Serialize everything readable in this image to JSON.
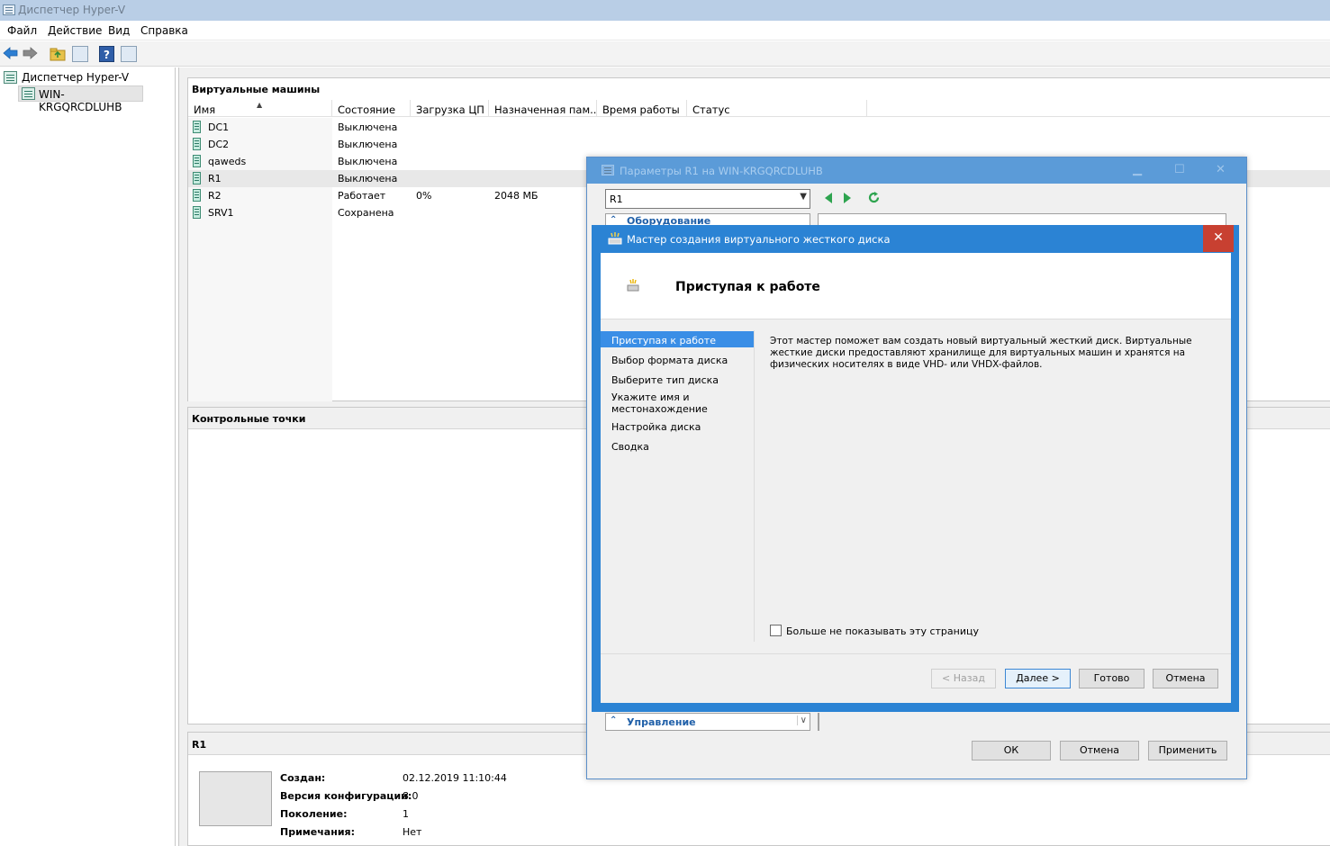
{
  "main_window": {
    "title": "Диспетчер Hyper-V"
  },
  "menu": [
    "Файл",
    "Действие",
    "Вид",
    "Справка"
  ],
  "tree": {
    "root": "Диспетчер Hyper-V",
    "server": "WIN-KRGQRCDLUHB"
  },
  "vm_panel": {
    "title": "Виртуальные машины",
    "columns": [
      "Имя",
      "Состояние",
      "Загрузка ЦП",
      "Назначенная пам...",
      "Время работы",
      "Статус"
    ],
    "rows": [
      {
        "name": "DC1",
        "state": "Выключена",
        "cpu": "",
        "mem": ""
      },
      {
        "name": "DC2",
        "state": "Выключена",
        "cpu": "",
        "mem": ""
      },
      {
        "name": "qaweds",
        "state": "Выключена",
        "cpu": "",
        "mem": ""
      },
      {
        "name": "R1",
        "state": "Выключена",
        "cpu": "",
        "mem": ""
      },
      {
        "name": "R2",
        "state": "Работает",
        "cpu": "0%",
        "mem": "2048 МБ"
      },
      {
        "name": "SRV1",
        "state": "Сохранена",
        "cpu": "",
        "mem": ""
      }
    ]
  },
  "checkpoints_panel": {
    "title": "Контрольные точки"
  },
  "details_panel": {
    "title": "R1",
    "fields": [
      {
        "label": "Создан:",
        "value": "02.12.2019 11:10:44"
      },
      {
        "label": "Версия конфигурации:",
        "value": "8.0"
      },
      {
        "label": "Поколение:",
        "value": "1"
      },
      {
        "label": "Примечания:",
        "value": "Нет"
      }
    ]
  },
  "settings_dialog": {
    "title": "Параметры R1 на WIN-KRGQRCDLUHB",
    "vm_select": "R1",
    "hardware_header": "Оборудование",
    "management_header": "Управление",
    "ok_label": "ОК",
    "cancel_label": "Отмена",
    "apply_label": "Применить"
  },
  "wizard": {
    "title": "Мастер создания виртуального жесткого диска",
    "heading": "Приступая к работе",
    "steps": [
      "Приступая к работе",
      "Выбор формата диска",
      "Выберите тип диска",
      "Укажите имя и местонахождение",
      "Настройка диска",
      "Сводка"
    ],
    "active_step": 0,
    "description": "Этот мастер поможет вам создать новый виртуальный жесткий диск. Виртуальные жесткие диски предоставляют хранилище для виртуальных машин и хранятся на физических носителях в виде VHD- или VHDX-файлов.",
    "checkbox_label": "Больше не показывать эту страницу",
    "back_label": "< Назад",
    "next_label": "Далее >",
    "finish_label": "Готово",
    "cancel_label": "Отмена",
    "close_glyph": "✕"
  },
  "colors": {
    "wizard_border": "#2b83d4",
    "active_step_bg": "#3a8ee6",
    "settings_title_bg": "#5b9bd8",
    "close_button_bg": "#c84031"
  }
}
